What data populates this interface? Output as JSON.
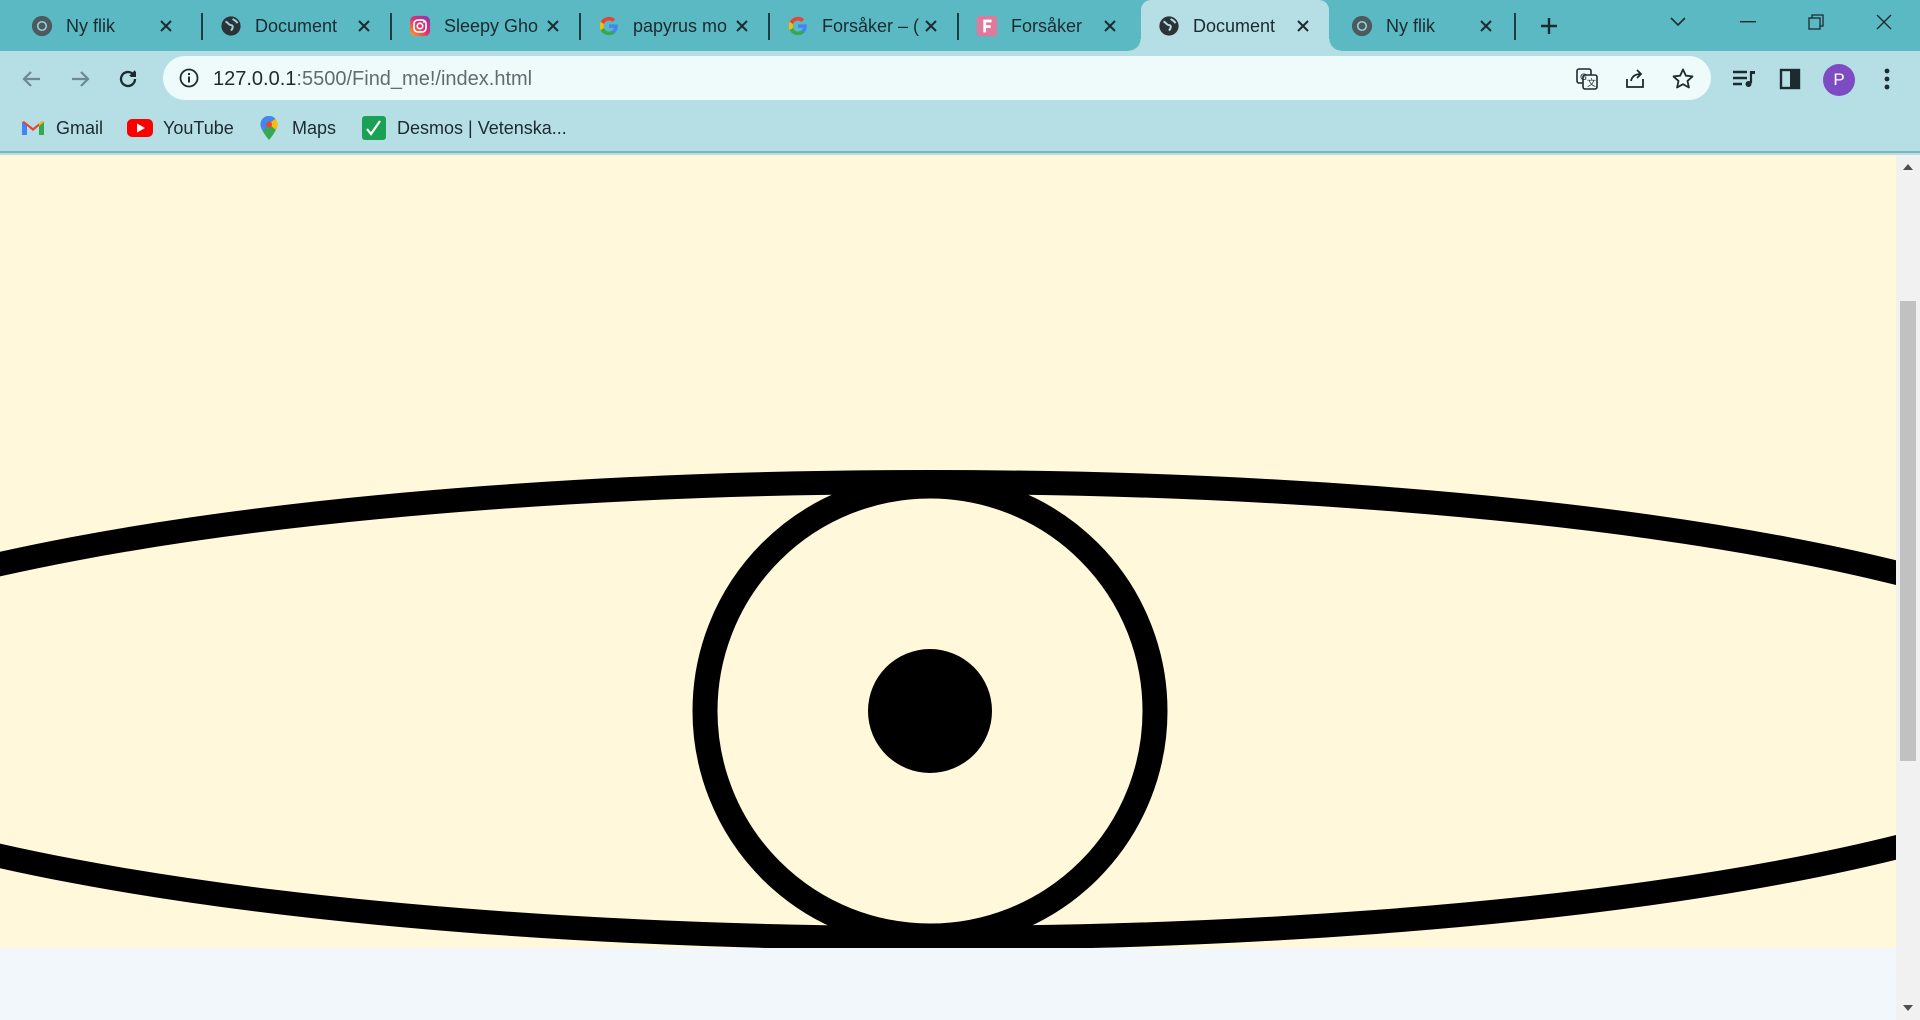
{
  "browser": {
    "tabs": [
      {
        "title": "Ny flik",
        "icon": "chrome-icon",
        "active": false
      },
      {
        "title": "Document",
        "icon": "globe-icon",
        "active": false
      },
      {
        "title": "Sleepy Gho",
        "icon": "instagram-icon",
        "active": false
      },
      {
        "title": "papyrus mo",
        "icon": "google-icon",
        "active": false
      },
      {
        "title": "Forsåker – (",
        "icon": "google-icon",
        "active": false
      },
      {
        "title": "Forsåker",
        "icon": "forsaker-icon",
        "active": false
      },
      {
        "title": "Document",
        "icon": "globe-icon",
        "active": true
      },
      {
        "title": "Ny flik",
        "icon": "chrome-icon",
        "active": false
      }
    ],
    "address_bar": {
      "host": "127.0.0.1",
      "path": ":5500/Find_me!/index.html"
    },
    "profile_initial": "P",
    "bookmarks": [
      {
        "label": "Gmail",
        "icon": "gmail-icon"
      },
      {
        "label": "YouTube",
        "icon": "youtube-icon"
      },
      {
        "label": "Maps",
        "icon": "maps-icon"
      },
      {
        "label": "Desmos | Vetenska...",
        "icon": "desmos-icon"
      }
    ]
  },
  "colors": {
    "tab_strip": "#5bb9c3",
    "toolbar": "#b5dfe4",
    "page_background": "#fff8db",
    "eye_stroke": "#000000",
    "avatar": "#7d4cc2"
  }
}
